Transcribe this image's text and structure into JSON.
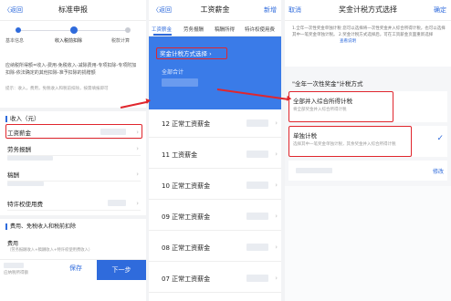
{
  "panel1": {
    "nav": {
      "back": "〈返回",
      "title": "标准申报"
    },
    "steps": [
      "基本信息",
      "收入税前扣除",
      "税款计算"
    ],
    "desc": "应纳税所得额=收入-费用-免税收入-减除费用-专项扣除-专项附加扣除-依法确定的其他扣除-准予扣除的捐赠额",
    "note": "提示：收入，费用，免税收入和税前扣除，按需填报即可",
    "income_header": "收入（元）",
    "rows": [
      "工资薪金",
      "劳务报酬",
      "稿酬",
      "特许权使用费"
    ],
    "deduct_header": "费用、免税收入和税前扣除",
    "fee_label": "费用",
    "fee_note": "（劳务报酬收入+稿酬收入+特许权使用费收入）",
    "bottom": {
      "tax_label": "应纳税所得额",
      "save": "保存",
      "next": "下一步"
    }
  },
  "panel2": {
    "nav": {
      "back": "〈返回",
      "title": "工资薪金",
      "right": "新增"
    },
    "tabs": [
      "工资薪金",
      "劳务报酬",
      "稿酬所得",
      "特许权使用费"
    ],
    "banner_option": "奖金计税方式选择",
    "banner_total": "全部合计",
    "items": [
      "12 正常工资薪金",
      "11 工资薪金",
      "10 正常工资薪金",
      "09 正常工资薪金",
      "08 正常工资薪金",
      "07 正常工资薪金"
    ]
  },
  "panel3": {
    "nav": {
      "left": "取消",
      "title": "奖金计税方式选择",
      "right": "确定"
    },
    "info": "1.全年一次性奖金单独计税 您可以选择将一次性奖金并入综合所得计税，也可以选择其中一笔奖金单独计税。  2.奖金计税方式选择后，可在工资薪金页面重新选择",
    "info_link": "查看说明",
    "section_title": "\"全年一次性奖金\"计税方式",
    "options": [
      {
        "title": "全部并入综合所得计税",
        "desc": "将全部奖金并入综合所得计税"
      },
      {
        "title": "单独计税",
        "desc": "选择其中一笔奖金单独计税，其余奖金并入综合所得计税"
      }
    ],
    "modify": "修改"
  },
  "colors": {
    "brand": "#2f6bdc",
    "highlight": "#e0262d"
  }
}
